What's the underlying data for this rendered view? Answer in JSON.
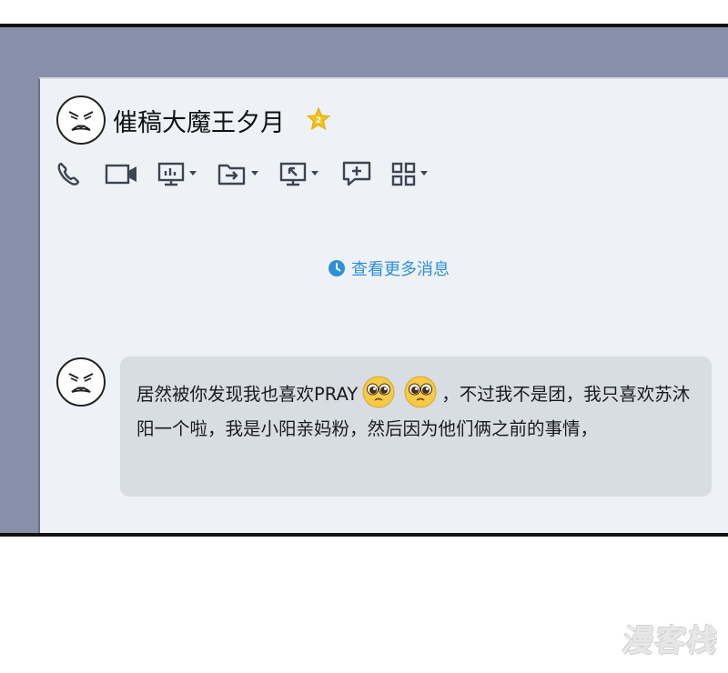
{
  "chat": {
    "contact_name": "催稿大魔王夕月",
    "load_more_label": "查看更多消息",
    "message_part1": "居然被你发现我也喜欢PRAY",
    "message_part2": "，不过我不是团，我只喜欢苏沐阳一个啦，我是小阳亲妈粉，然后因为他们俩之前的事情，"
  },
  "toolbar_icons": [
    "phone-icon",
    "video-call-icon",
    "screen-share-icon",
    "file-transfer-icon",
    "remote-desktop-icon",
    "add-comment-icon",
    "apps-grid-icon"
  ],
  "emoji": [
    "pleading-face-emoji",
    "pleading-face-emoji"
  ],
  "watermark": "漫客栈",
  "colors": {
    "panel_bg": "#8790a8",
    "window_bg": "#eef2f7",
    "bubble_bg": "#d8dde4",
    "link_blue": "#2f8fd8",
    "star_gold": "#f4c21a"
  }
}
